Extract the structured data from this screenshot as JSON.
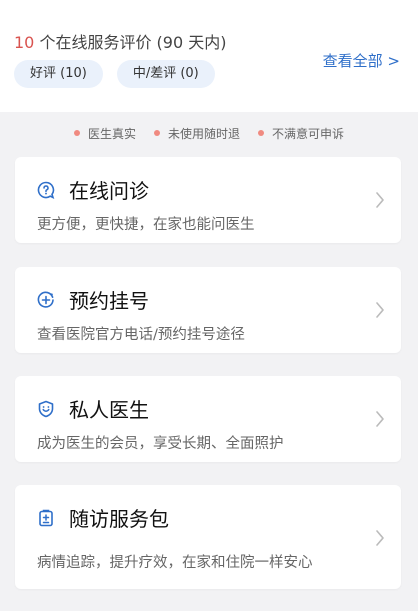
{
  "reviews": {
    "count": "10",
    "title_suffix": " 个在线服务评价 (90 天内)",
    "view_all": "查看全部 >",
    "chips": [
      {
        "label": "好评 (10)"
      },
      {
        "label": "中/差评 (0)"
      }
    ]
  },
  "guarantees": [
    {
      "text": "医生真实"
    },
    {
      "text": "未使用随时退"
    },
    {
      "text": "不满意可申诉"
    }
  ],
  "services": [
    {
      "title": "在线问诊",
      "desc": "更方便，更快捷，在家也能问医生",
      "icon": "chat-question-icon"
    },
    {
      "title": "预约挂号",
      "desc": "查看医院官方电话/预约挂号途径",
      "icon": "plus-circle-icon"
    },
    {
      "title": "私人医生",
      "desc": "成为医生的会员，享受长期、全面照护",
      "icon": "doctor-shield-icon"
    },
    {
      "title": "随访服务包",
      "desc": "病情追踪，提升疗效，在家和住院一样安心",
      "icon": "clipboard-icon"
    }
  ],
  "colors": {
    "accent_blue": "#2f6fc9",
    "count_red": "#d9534f",
    "chip_bg": "#eaf1fb",
    "dot": "#f08a80"
  }
}
